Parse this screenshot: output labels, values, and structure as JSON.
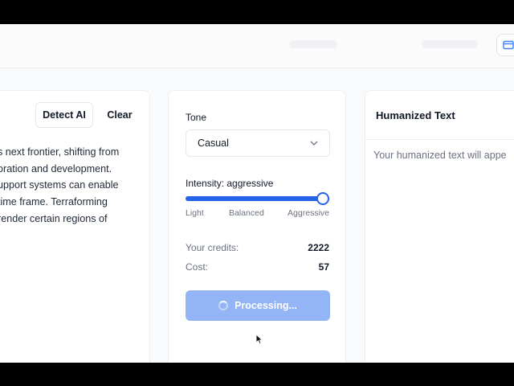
{
  "left_panel": {
    "detect_button": "Detect AI",
    "clear_button": "Clear",
    "text_lines": [
      "s next frontier, shifting from",
      "oration and development.",
      "upport systems can enable",
      " time frame. Terraforming",
      " render certain regions of"
    ]
  },
  "controls": {
    "tone_label": "Tone",
    "tone_value": "Casual",
    "intensity_label": "Intensity: aggressive",
    "intensity_level": 0.95,
    "scale_light": "Light",
    "scale_balanced": "Balanced",
    "scale_aggressive": "Aggressive",
    "credits_label": "Your credits:",
    "credits_value": "2222",
    "cost_label": "Cost:",
    "cost_value": "57",
    "process_button": "Processing..."
  },
  "output_panel": {
    "title": "Humanized Text",
    "placeholder": "Your humanized text will appe"
  },
  "colors": {
    "accent": "#2563eb",
    "button_disabled": "#93b4f5"
  }
}
